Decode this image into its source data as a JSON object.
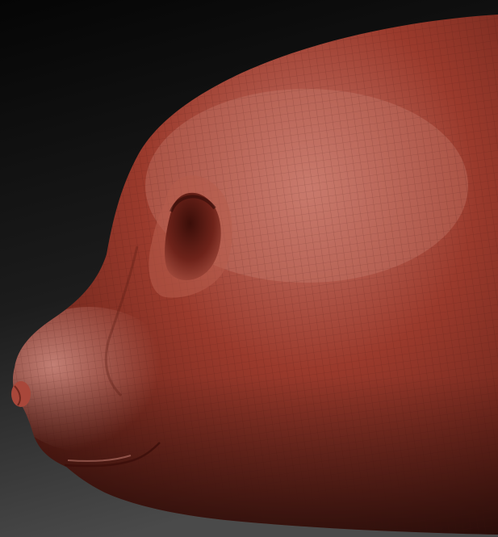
{
  "scene": {
    "subject": "sculpted-animal-head-profile",
    "colors": {
      "background_top": "#050505",
      "background_bottom": "#4a4a4a",
      "clay_base": "#9a3a2c",
      "clay_dark": "#5a1c14",
      "clay_highlight": "#c9776a",
      "wire": "#3c120d"
    }
  }
}
